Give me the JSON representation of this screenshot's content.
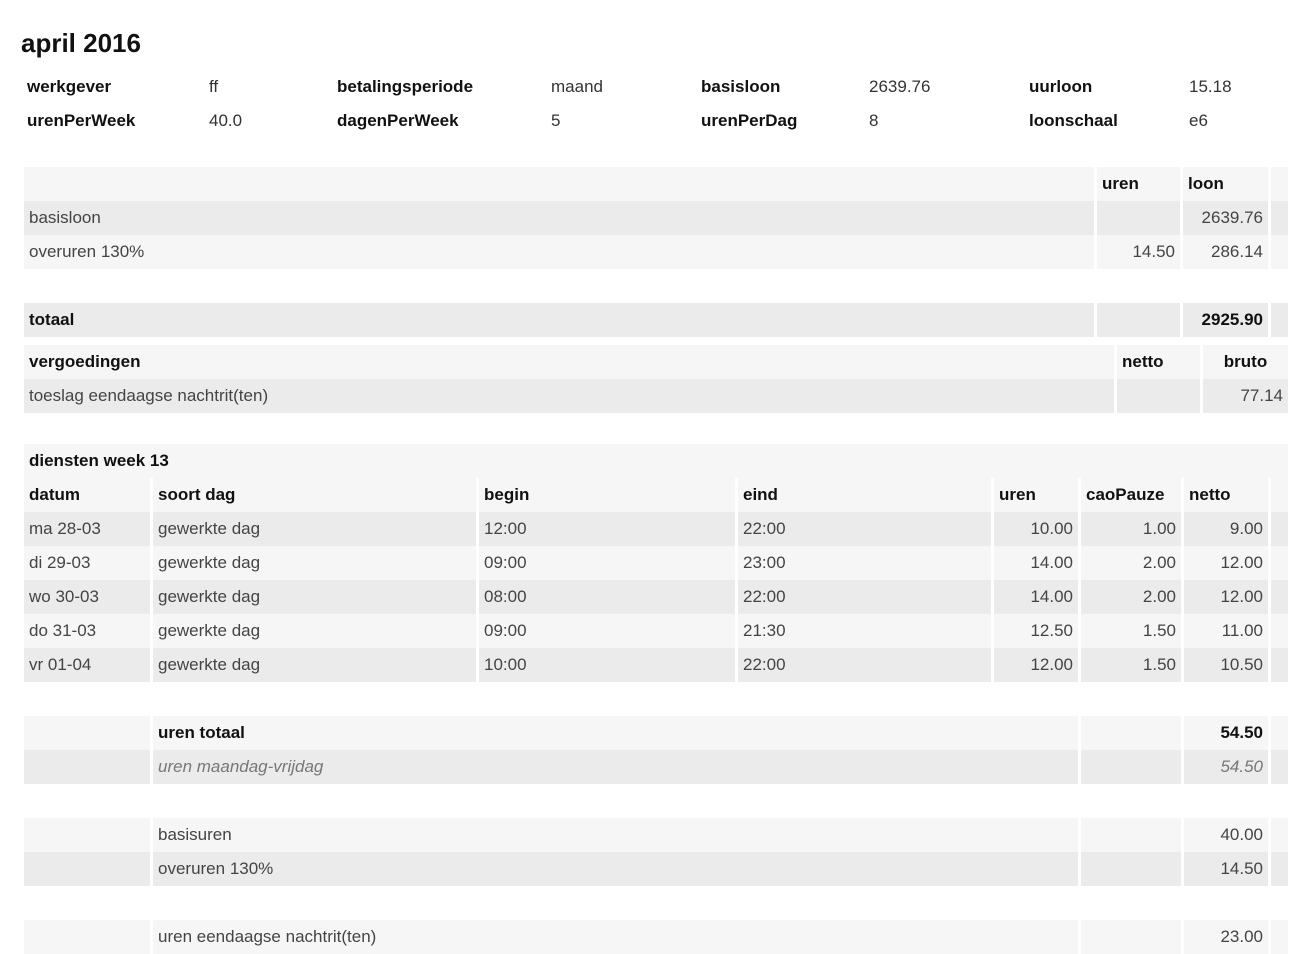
{
  "page": {
    "title": "april 2016"
  },
  "info": [
    [
      {
        "label": "werkgever",
        "value": "ff"
      },
      {
        "label": "betalingsperiode",
        "value": "maand"
      },
      {
        "label": "basisloon",
        "value": "2639.76"
      },
      {
        "label": "uurloon",
        "value": "15.18"
      }
    ],
    [
      {
        "label": "urenPerWeek",
        "value": "40.0"
      },
      {
        "label": "dagenPerWeek",
        "value": "5"
      },
      {
        "label": "urenPerDag",
        "value": "8"
      },
      {
        "label": "loonschaal",
        "value": "e6"
      }
    ]
  ],
  "loon": {
    "headers": {
      "uren": "uren",
      "loon": "loon"
    },
    "rows": [
      {
        "label": "basisloon",
        "uren": "",
        "loon": "2639.76"
      },
      {
        "label": "overuren 130%",
        "uren": "14.50",
        "loon": "286.14"
      }
    ],
    "totaal": {
      "label": "totaal",
      "loon": "2925.90"
    }
  },
  "vergoedingen": {
    "headers": {
      "title": "vergoedingen",
      "netto": "netto",
      "bruto": "bruto"
    },
    "rows": [
      {
        "label": "toeslag eendaagse nachtrit(ten)",
        "netto": "",
        "bruto": "77.14"
      }
    ]
  },
  "diensten": {
    "title": "diensten week 13",
    "headers": {
      "datum": "datum",
      "soort": "soort dag",
      "begin": "begin",
      "eind": "eind",
      "uren": "uren",
      "pauze": "caoPauze",
      "netto": "netto"
    },
    "rows": [
      {
        "datum": "ma 28-03",
        "soort": "gewerkte dag",
        "begin": "12:00",
        "eind": "22:00",
        "uren": "10.00",
        "pauze": "1.00",
        "netto": "9.00"
      },
      {
        "datum": "di 29-03",
        "soort": "gewerkte dag",
        "begin": "09:00",
        "eind": "23:00",
        "uren": "14.00",
        "pauze": "2.00",
        "netto": "12.00"
      },
      {
        "datum": "wo 30-03",
        "soort": "gewerkte dag",
        "begin": "08:00",
        "eind": "22:00",
        "uren": "14.00",
        "pauze": "2.00",
        "netto": "12.00"
      },
      {
        "datum": "do 31-03",
        "soort": "gewerkte dag",
        "begin": "09:00",
        "eind": "21:30",
        "uren": "12.50",
        "pauze": "1.50",
        "netto": "11.00"
      },
      {
        "datum": "vr 01-04",
        "soort": "gewerkte dag",
        "begin": "10:00",
        "eind": "22:00",
        "uren": "12.00",
        "pauze": "1.50",
        "netto": "10.50"
      }
    ],
    "summary": {
      "uren_totaal": {
        "label": "uren totaal",
        "value": "54.50"
      },
      "uren_ma_vr": {
        "label": "uren maandag-vrijdag",
        "value": "54.50"
      },
      "basisuren": {
        "label": "basisuren",
        "value": "40.00"
      },
      "overuren": {
        "label": "overuren 130%",
        "value": "14.50"
      },
      "nachtrit": {
        "label": "uren eendaagse nachtrit(ten)",
        "value": "23.00"
      }
    }
  }
}
